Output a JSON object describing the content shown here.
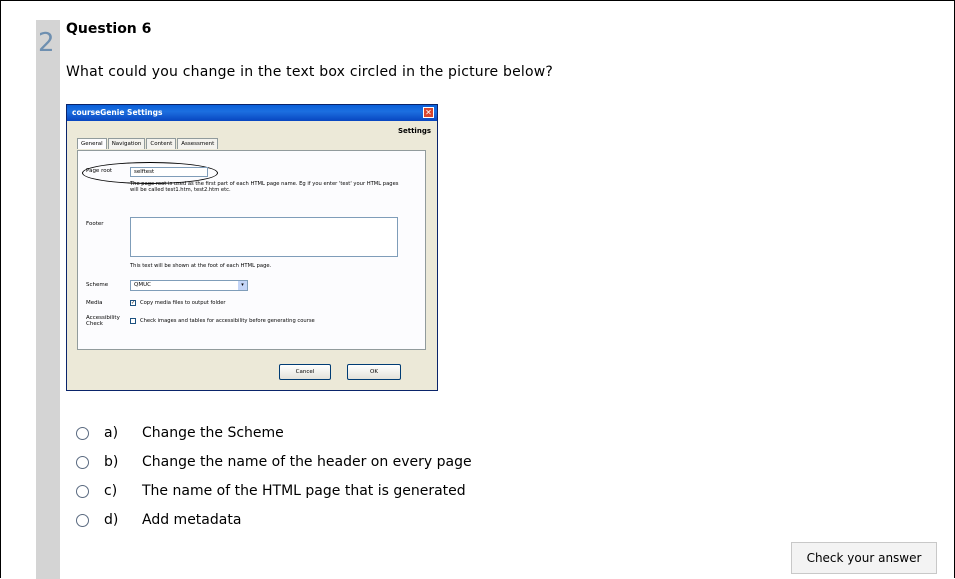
{
  "question": {
    "number": "2",
    "title": "Question 6",
    "text": "What could you change in the text box circled in the picture below?"
  },
  "dialog": {
    "title": "courseGenie Settings",
    "close": "✕",
    "heading": "Settings",
    "tabs": [
      "General",
      "Navigation",
      "Content",
      "Assessment"
    ],
    "page_root_label": "Page root",
    "page_root_value": "selftest",
    "page_root_help": "The page root is used as the first part of each HTML page name. Eg if you enter 'test' your HTML pages will be called test1.htm, test2.htm etc.",
    "footer_label": "Footer",
    "footer_help": "This text will be shown at the foot of each HTML page.",
    "scheme_label": "Scheme",
    "scheme_value": "QMUC",
    "media_label": "Media",
    "media_check": "Copy media files to output folder",
    "access_label": "Accessibility Check",
    "access_check": "Check images and tables for accessibility before generating course",
    "cancel": "Cancel",
    "ok": "OK"
  },
  "options": [
    {
      "letter": "a)",
      "text": "Change the Scheme"
    },
    {
      "letter": "b)",
      "text": "Change the name of the header on every page"
    },
    {
      "letter": "c)",
      "text": "The name of the HTML page that is generated"
    },
    {
      "letter": "d)",
      "text": "Add metadata"
    }
  ],
  "check_button": "Check your answer"
}
